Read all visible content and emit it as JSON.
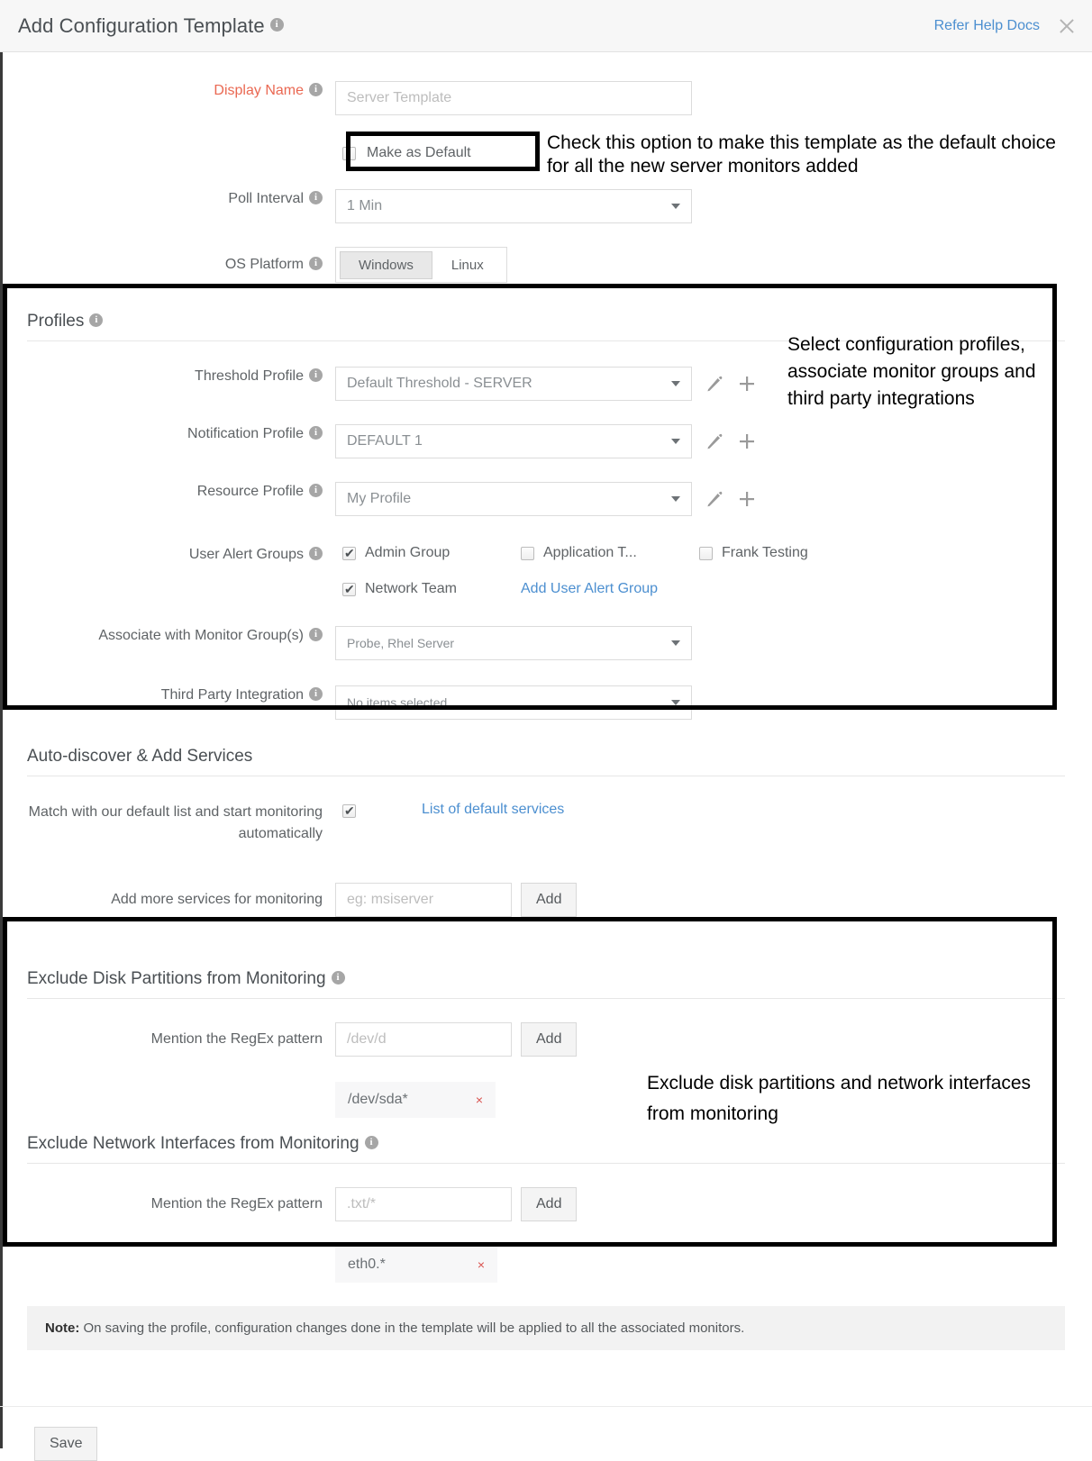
{
  "header": {
    "title": "Add Configuration Template",
    "help_link": "Refer Help Docs",
    "close_icon": "close-icon",
    "info_icon": "info-icon"
  },
  "form": {
    "display_name": {
      "label": "Display Name",
      "value": "Server Template",
      "placeholder": "Server Template"
    },
    "make_default": {
      "label": "Make as Default",
      "checked": false
    },
    "poll_interval": {
      "label": "Poll Interval",
      "value": "1 Min"
    },
    "os_platform": {
      "label": "OS Platform",
      "options": [
        "Windows",
        "Linux"
      ],
      "selected": "Windows"
    }
  },
  "profiles": {
    "heading": "Profiles",
    "threshold_profile": {
      "label": "Threshold Profile",
      "value": "Default Threshold - SERVER"
    },
    "notification_profile": {
      "label": "Notification Profile",
      "value": "DEFAULT 1"
    },
    "resource_profile": {
      "label": "Resource Profile",
      "value": "My Profile"
    },
    "user_alert_groups": {
      "label": "User Alert Groups",
      "items": [
        {
          "label": "Admin Group",
          "checked": true
        },
        {
          "label": "Application T...",
          "checked": false
        },
        {
          "label": "Frank Testing",
          "checked": false
        },
        {
          "label": "Network Team",
          "checked": true
        }
      ],
      "add_link": "Add User Alert Group"
    },
    "monitor_groups": {
      "label": "Associate with Monitor Group(s)",
      "value": "Probe, Rhel Server"
    },
    "third_party": {
      "label": "Third Party Integration",
      "value": "No items selected"
    },
    "edit_icon": "pencil-icon",
    "add_icon": "plus-icon"
  },
  "autodiscover": {
    "heading": "Auto-discover & Add Services",
    "match_default": {
      "label": "Match with our default list and start monitoring automatically",
      "checked": true,
      "link": "List of default services"
    },
    "add_services": {
      "label": "Add more services for monitoring",
      "placeholder": "eg: msiserver",
      "value": "",
      "button": "Add"
    }
  },
  "exclude_disk": {
    "heading": "Exclude Disk Partitions from Monitoring",
    "regex": {
      "label": "Mention the RegEx pattern",
      "placeholder": "/dev/d",
      "value": "",
      "button": "Add"
    },
    "chips": [
      {
        "text": "/dev/sda*",
        "remove": "×"
      }
    ]
  },
  "exclude_network": {
    "heading": "Exclude Network Interfaces from Monitoring",
    "regex": {
      "label": "Mention the RegEx pattern",
      "placeholder": ".txt/*",
      "value": "",
      "button": "Add"
    },
    "chips": [
      {
        "text": "eth0.*",
        "remove": "×"
      }
    ]
  },
  "note": {
    "prefix": "Note:",
    "text": " On saving the profile, configuration changes done in the template will be applied to all the associated monitors."
  },
  "footer": {
    "save_label": "Save"
  },
  "annotations": {
    "make_default": "Check this option to make this template as the default choice for all the new server monitors added",
    "profiles": "Select configuration profiles, associate monitor groups and third party integrations",
    "exclude": "Exclude disk partitions and network interfaces from monitoring"
  },
  "colors": {
    "accent_link": "#4c8fd0",
    "required_label": "#ea6852",
    "chip_remove": "#d9534f",
    "annotation": "#000000"
  }
}
